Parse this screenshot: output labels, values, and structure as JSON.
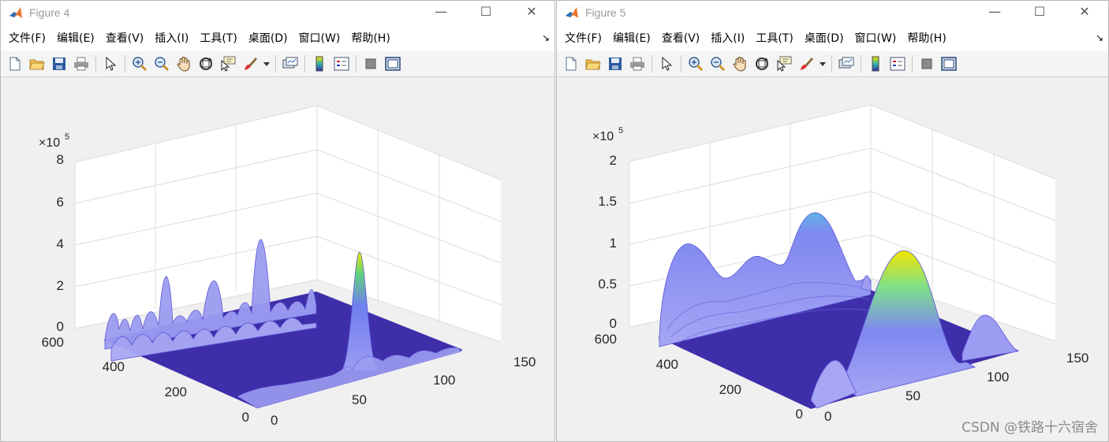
{
  "menus": [
    "文件(F)",
    "编辑(E)",
    "查看(V)",
    "插入(I)",
    "工具(T)",
    "桌面(D)",
    "窗口(W)",
    "帮助(H)"
  ],
  "toolbar_icons": [
    "new-figure-icon",
    "open-file-icon",
    "save-icon",
    "print-icon",
    "pointer-icon",
    "zoom-in-icon",
    "zoom-out-icon",
    "pan-icon",
    "rotate-3d-icon",
    "data-cursor-icon",
    "brush-icon",
    "brush-dropdown-icon",
    "link-plot-icon",
    "colorbar-icon",
    "legend-icon",
    "hide-plot-tools-icon",
    "show-plot-tools-icon"
  ],
  "colors": {
    "surface_base": "#3f2eaa",
    "surface_mesh": "#9c9cf2",
    "peak_yellow": "#f2e400",
    "peak_green": "#5fd37a"
  },
  "figure4": {
    "title": "Figure 4",
    "window_buttons": {
      "minimize": "—",
      "maximize": "☐",
      "close": "✕"
    },
    "exponent_base": "×10",
    "exponent_power": "5",
    "z_ticks": [
      "8",
      "6",
      "4",
      "2",
      "0"
    ],
    "y_ticks": [
      "600",
      "400",
      "200",
      "0"
    ],
    "x_ticks": [
      "0",
      "50",
      "100",
      "150"
    ]
  },
  "figure5": {
    "title": "Figure 5",
    "window_buttons": {
      "minimize": "—",
      "maximize": "☐",
      "close": "✕"
    },
    "exponent_base": "×10",
    "exponent_power": "5",
    "z_ticks": [
      "2",
      "1.5",
      "1",
      "0.5",
      "0"
    ],
    "y_ticks": [
      "600",
      "400",
      "200",
      "0"
    ],
    "x_ticks": [
      "0",
      "50",
      "100",
      "150"
    ]
  },
  "watermark": "CSDN @铁路十六宿舍"
}
